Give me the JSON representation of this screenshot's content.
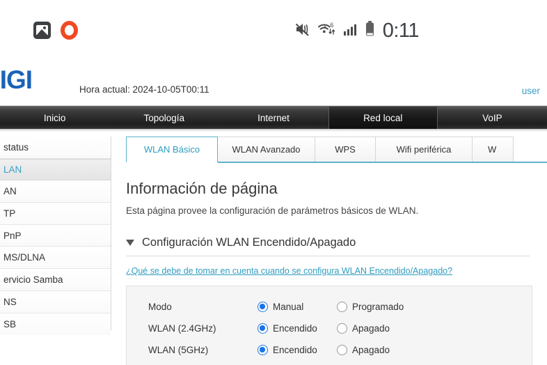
{
  "status_bar": {
    "time": "0:11",
    "icons": [
      "gallery-icon",
      "opera-icon",
      "mute-vibrate-icon",
      "wifi-6-icon",
      "cellular-signal-icon",
      "battery-icon"
    ],
    "wifi_generation": "6"
  },
  "router_header": {
    "logo_text": "DIGI",
    "current_time_label": "Hora actual: 2024-10-05T00:11",
    "user_link": "user",
    "logo_color": "#1a63b8",
    "accent_color": "#3b9fc4"
  },
  "main_nav": {
    "items": [
      {
        "label": "Inicio",
        "active": false
      },
      {
        "label": "Topología",
        "active": false
      },
      {
        "label": "Internet",
        "active": false
      },
      {
        "label": "Red local",
        "active": true
      },
      {
        "label": "VoIP",
        "active": false
      }
    ]
  },
  "sidebar": {
    "items": [
      {
        "label": "status",
        "active": false
      },
      {
        "label": "LAN",
        "active": true
      },
      {
        "label": "AN",
        "active": false
      },
      {
        "label": "TP",
        "active": false
      },
      {
        "label": "PnP",
        "active": false
      },
      {
        "label": "MS/DLNA",
        "active": false
      },
      {
        "label": "ervicio Samba",
        "active": false
      },
      {
        "label": "NS",
        "active": false
      },
      {
        "label": "SB",
        "active": false
      }
    ]
  },
  "subtabs": {
    "items": [
      {
        "label": "WLAN Básico",
        "active": true
      },
      {
        "label": "WLAN Avanzado",
        "active": false
      },
      {
        "label": "WPS",
        "active": false
      },
      {
        "label": "Wifi periférica",
        "active": false
      },
      {
        "label": "W",
        "active": false
      }
    ]
  },
  "page": {
    "title": "Información de página",
    "description": "Esta página provee la configuración de parámetros básicos de WLAN.",
    "section_title": "Configuración WLAN Encendido/Apagado",
    "help_link": "¿Qué se debe de tomar en cuenta cuando se configura WLAN Encendido/Apagado?",
    "radio_accent": "#1a73e8"
  },
  "form": {
    "rows": [
      {
        "label": "Modo",
        "options": [
          {
            "label": "Manual",
            "checked": true
          },
          {
            "label": "Programado",
            "checked": false
          }
        ]
      },
      {
        "label": "WLAN (2.4GHz)",
        "options": [
          {
            "label": "Encendido",
            "checked": true
          },
          {
            "label": "Apagado",
            "checked": false
          }
        ]
      },
      {
        "label": "WLAN (5GHz)",
        "options": [
          {
            "label": "Encendido",
            "checked": true
          },
          {
            "label": "Apagado",
            "checked": false
          }
        ]
      }
    ]
  }
}
